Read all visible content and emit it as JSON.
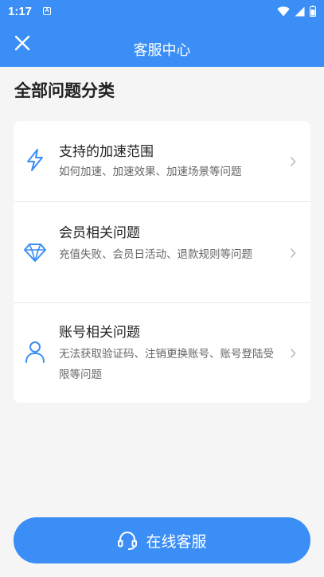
{
  "status_bar": {
    "time": "1:17",
    "notification_letter": "A"
  },
  "app_bar": {
    "title": "客服中心",
    "close_icon": "close-icon"
  },
  "section": {
    "title": "全部问题分类"
  },
  "categories": [
    {
      "icon": "lightning-icon",
      "title": "支持的加速范围",
      "desc": "如何加速、加速效果、加速场景等问题"
    },
    {
      "icon": "diamond-icon",
      "title": "会员相关问题",
      "desc": "充值失败、会员日活动、退款规则等问题"
    },
    {
      "icon": "user-icon",
      "title": "账号相关问题",
      "desc": "无法获取验证码、注销更换账号、账号登陆受限等问题"
    }
  ],
  "cta": {
    "label": "在线客服",
    "icon": "headset-icon"
  },
  "colors": {
    "primary": "#3a8ef6",
    "background": "#f5f5f5",
    "card": "#ffffff"
  }
}
